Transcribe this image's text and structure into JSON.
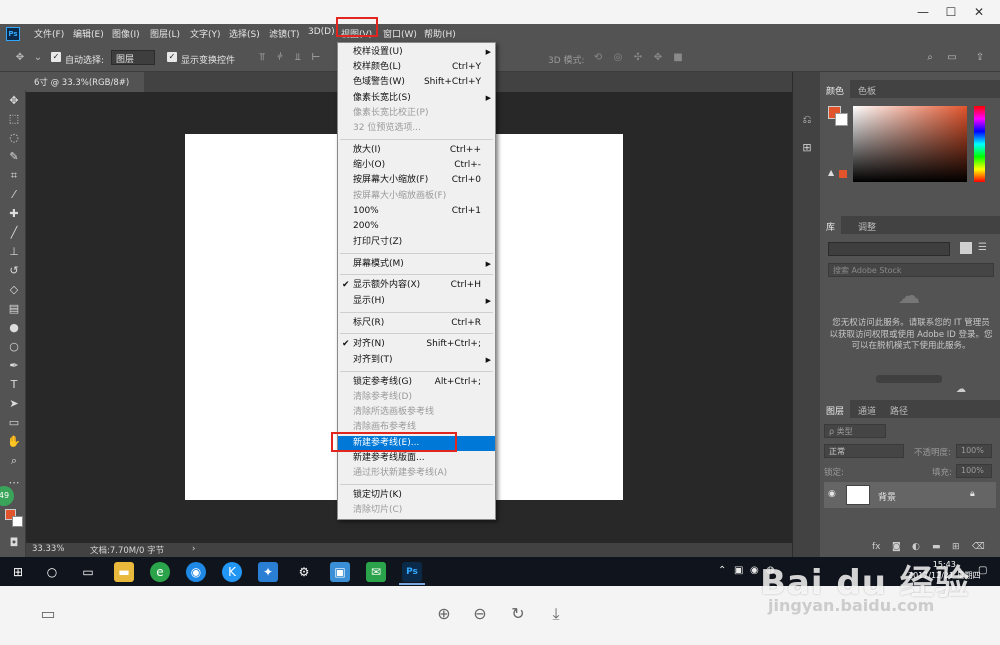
{
  "window_controls": {
    "minimize": "—",
    "maximize": "☐",
    "close": "✕"
  },
  "menubar": {
    "logo": "Ps",
    "items": [
      "文件(F)",
      "编辑(E)",
      "图像(I)",
      "图层(L)",
      "文字(Y)",
      "选择(S)",
      "滤镜(T)",
      "3D(D)",
      "视图(V)",
      "窗口(W)",
      "帮助(H)"
    ]
  },
  "options": {
    "auto_select_label": "自动选择:",
    "auto_select_value": "图层",
    "show_transform_label": "显示变换控件",
    "mode_3d_label": "3D 模式:"
  },
  "document_tab": "6寸 @ 33.3%(RGB/8#)",
  "status": {
    "zoom": "33.33%",
    "doc_info": "文档:7.70M/0 字节"
  },
  "tool_badge": "49",
  "view_menu": {
    "items": [
      {
        "label": "校样设置(U)",
        "shortcut": "",
        "submenu": true
      },
      {
        "label": "校样颜色(L)",
        "shortcut": "Ctrl+Y"
      },
      {
        "label": "色域警告(W)",
        "shortcut": "Shift+Ctrl+Y"
      },
      {
        "label": "像素长宽比(S)",
        "shortcut": "",
        "submenu": true
      },
      {
        "label": "像素长宽比校正(P)",
        "shortcut": "",
        "disabled": true
      },
      {
        "label": "32 位预览选项...",
        "shortcut": "",
        "disabled": true
      },
      {
        "label": "放大(I)",
        "shortcut": "Ctrl++"
      },
      {
        "label": "缩小(O)",
        "shortcut": "Ctrl+-"
      },
      {
        "label": "按屏幕大小缩放(F)",
        "shortcut": "Ctrl+0"
      },
      {
        "label": "按屏幕大小缩放画板(F)",
        "shortcut": "",
        "disabled": true
      },
      {
        "label": "100%",
        "shortcut": "Ctrl+1"
      },
      {
        "label": "200%",
        "shortcut": ""
      },
      {
        "label": "打印尺寸(Z)",
        "shortcut": ""
      },
      {
        "label": "屏幕模式(M)",
        "shortcut": "",
        "submenu": true
      },
      {
        "label": "显示额外内容(X)",
        "shortcut": "Ctrl+H",
        "checked": true
      },
      {
        "label": "显示(H)",
        "shortcut": "",
        "submenu": true
      },
      {
        "label": "标尺(R)",
        "shortcut": "Ctrl+R"
      },
      {
        "label": "对齐(N)",
        "shortcut": "Shift+Ctrl+;",
        "checked": true
      },
      {
        "label": "对齐到(T)",
        "shortcut": "",
        "submenu": true
      },
      {
        "label": "锁定参考线(G)",
        "shortcut": "Alt+Ctrl+;"
      },
      {
        "label": "清除参考线(D)",
        "shortcut": "",
        "disabled": true
      },
      {
        "label": "清除所选画板参考线",
        "shortcut": "",
        "disabled": true
      },
      {
        "label": "清除画布参考线",
        "shortcut": "",
        "disabled": true
      },
      {
        "label": "新建参考线(E)...",
        "shortcut": "",
        "highlighted": true
      },
      {
        "label": "新建参考线版面...",
        "shortcut": ""
      },
      {
        "label": "通过形状新建参考线(A)",
        "shortcut": "",
        "disabled": true
      },
      {
        "label": "锁定切片(K)",
        "shortcut": ""
      },
      {
        "label": "清除切片(C)",
        "shortcut": "",
        "disabled": true
      }
    ]
  },
  "panels": {
    "color_tabs": [
      "颜色",
      "色板"
    ],
    "library_tabs": [
      "库",
      "调整"
    ],
    "library_search_placeholder": "搜索 Adobe Stock",
    "library_message": "您无权访问此服务。请联系您的 IT 管理员以获取访问权限或使用 Adobe ID 登录。您可以在脱机模式下使用此服务。",
    "layers_tabs": [
      "图层",
      "通道",
      "路径"
    ],
    "layer_filter": "ρ 类型",
    "blend_mode": "正常",
    "opacity_label": "不透明度:",
    "opacity_value": "100%",
    "lock_label": "锁定:",
    "fill_label": "填充:",
    "fill_value": "100%",
    "layer_name": "背景"
  },
  "taskbar": {
    "time": "15:43",
    "date": "2017/12/21 星期四"
  },
  "watermark": {
    "brand": "Bai du 经验",
    "url": "jingyan.baidu.com"
  },
  "colors": {
    "accent": "#0078d7",
    "highlight_box": "#e0261f",
    "foreground": "#e1542c"
  }
}
